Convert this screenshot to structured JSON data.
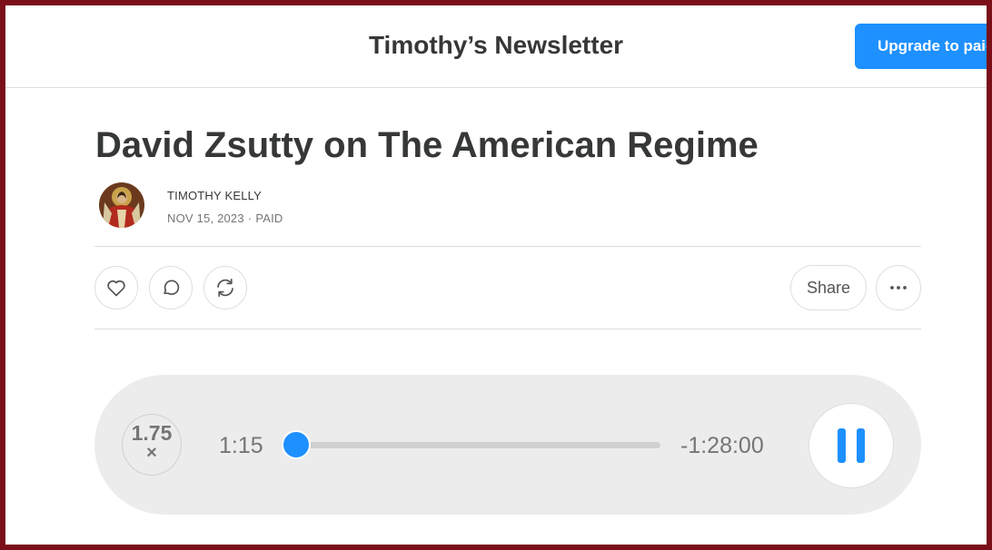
{
  "header": {
    "publication_title": "Timothy’s Newsletter",
    "upgrade_label": "Upgrade to paid"
  },
  "post": {
    "title": "David Zsutty on The American Regime",
    "author": "TIMOTHY KELLY",
    "date": "NOV 15, 2023",
    "separator": "·",
    "access": "PAID"
  },
  "actions": {
    "like_icon": "heart-icon",
    "comment_icon": "comment-bubble-icon",
    "restack_icon": "restack-arrows-icon",
    "share_label": "Share",
    "more_icon": "ellipsis-icon"
  },
  "player": {
    "speed_value": "1.75",
    "speed_suffix": "×",
    "elapsed": "1:15",
    "remaining": "-1:28:00",
    "progress_fraction": 0.014,
    "state_icon": "pause-icon"
  },
  "colors": {
    "accent": "#1e90ff",
    "frame": "#7a0f1a",
    "text": "#363737",
    "muted": "#757575",
    "player_bg": "#ececec"
  }
}
